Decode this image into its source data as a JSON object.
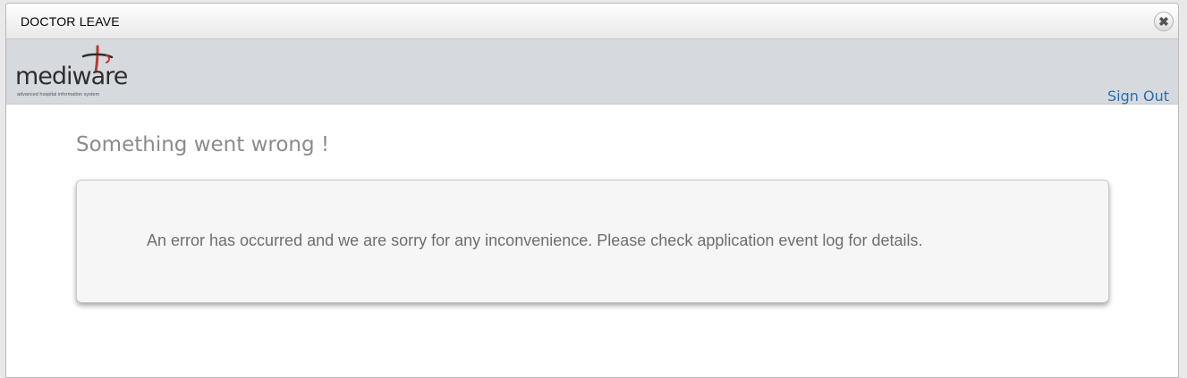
{
  "window": {
    "title": "DOCTOR LEAVE",
    "close_icon": "close-icon"
  },
  "header": {
    "logo_text": "mediware",
    "logo_tagline": "advanced hospital information system",
    "logo_accent_color": "#c0392b",
    "signout_label": "Sign Out"
  },
  "error": {
    "title": "Something went wrong !",
    "message": "An error has occurred and we are sorry for any inconvenience. Please check application event log for details."
  },
  "colors": {
    "header_bg": "#d6dade",
    "link": "#2b6cb0",
    "error_title": "#8e8a8a",
    "error_text": "#6e6e6e"
  }
}
